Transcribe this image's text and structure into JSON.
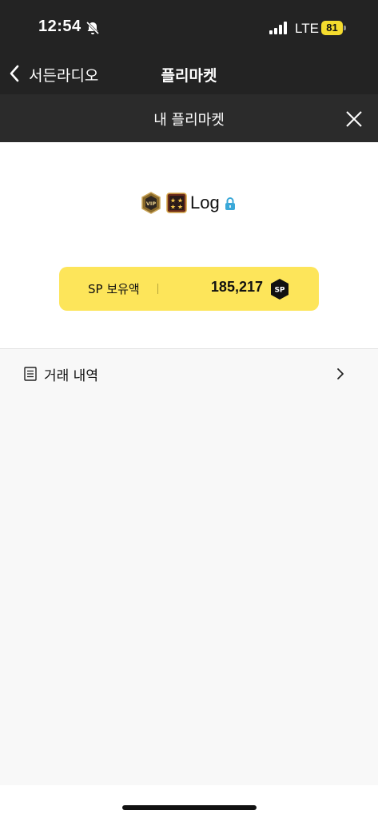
{
  "status_bar": {
    "time": "12:54",
    "network": "LTE",
    "battery": "81"
  },
  "nav": {
    "back_label": "서든라디오",
    "title": "플리마켓"
  },
  "sub_header": {
    "title": "내 플리마켓"
  },
  "profile": {
    "badge_text": "VIP",
    "username": "Log"
  },
  "balance": {
    "label": "SP 보유액",
    "value": "185,217",
    "coin_label": "SP"
  },
  "history": {
    "label": "거래 내역"
  },
  "colors": {
    "header_bg": "#232323",
    "accent_yellow": "#fde55a",
    "lock_blue": "#3aa8d8"
  }
}
